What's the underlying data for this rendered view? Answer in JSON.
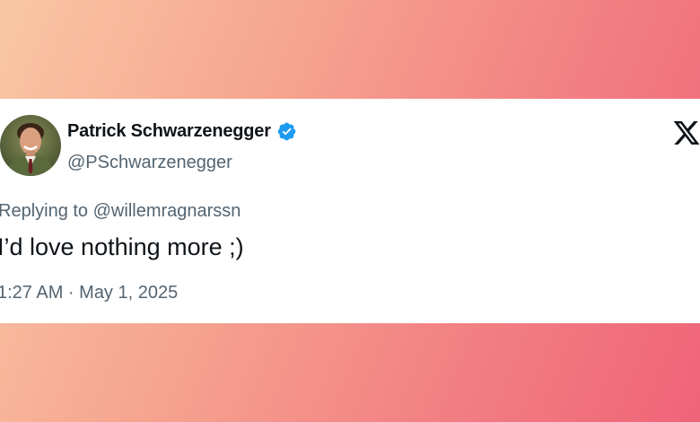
{
  "tweet": {
    "author": {
      "display_name": "Patrick Schwarzenegger",
      "handle": "@PSchwarzenegger",
      "verified_icon": "verified-badge-icon",
      "avatar": "avatar-photo"
    },
    "platform_logo": "x-logo-icon",
    "replying_to_prefix": "Replying to",
    "replying_to_handle": "@willemragnarssn",
    "text": "I’d love nothing more ;)",
    "timestamp": "1:27 AM · May 1, 2025"
  },
  "colors": {
    "background_gradient": [
      "#f9c7a4",
      "#f6a58f",
      "#f27f83",
      "#ef6478"
    ],
    "card": "#ffffff",
    "text_primary": "#0f1419",
    "text_secondary": "#536471",
    "verified_blue": "#1d9bf0"
  }
}
